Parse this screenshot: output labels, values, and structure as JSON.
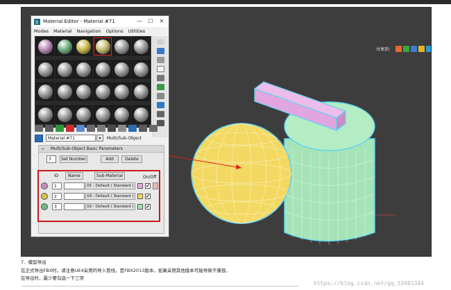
{
  "window": {
    "title": "Material Editor - Material #71",
    "minimize": "—",
    "maximize": "☐",
    "close": "✕"
  },
  "menu": [
    "Modes",
    "Material",
    "Navigation",
    "Options",
    "Utilities"
  ],
  "material_slots": {
    "rows": 4,
    "cols": 6,
    "selected_index": 3,
    "sample_colors": [
      "#b98ab7",
      "#6fae80",
      "#c9b64a",
      "#c4b96e"
    ]
  },
  "name_bar": {
    "material_name": "Material #71",
    "material_type": "Multi/Sub-Object"
  },
  "rollout": {
    "title": "Multi/Sub-Object Basic Parameters",
    "count_value": "3",
    "set_number_label": "Set Number",
    "add_label": "Add",
    "delete_label": "Delete",
    "col_id": "ID",
    "col_name": "Name",
    "col_submaterial": "Sub-Material",
    "col_onoff": "On/Off",
    "rows": [
      {
        "id": "1",
        "material": "01 - Default ( Standard )",
        "color": "#f0a6e4",
        "sphere": "#c48fc4",
        "checked": "✔"
      },
      {
        "id": "2",
        "material": "03 - Default ( Standard )",
        "color": "#f2dc57",
        "sphere": "#d8c24a",
        "checked": "✔"
      },
      {
        "id": "3",
        "material": "02 - Default ( Standard )",
        "color": "#a4e6b8",
        "sphere": "#74b888",
        "checked": "✔"
      }
    ]
  },
  "viewport": {
    "share_label": "分享到：",
    "share_icons": [
      "qzone-icon",
      "wechat-icon",
      "weibo-icon",
      "star-icon",
      "tencent-icon",
      "plus-icon"
    ]
  },
  "captions": {
    "line1": "7．模型导出",
    "line2": "在正式导出FBX时，请注意UE4采用的导入管线，是FBX2013版本，如果采用其他版本可能导致不兼容。",
    "line3": "在导出时，最少要勾选一下三项"
  },
  "watermark": "https://blog.csdn.net/qq_33483344",
  "colors": {
    "viewport_bg": "#3d3d3d",
    "selection_red": "#c8191c",
    "sphere_yellow": "#f3d961",
    "cylinder_green": "#a6e4b8",
    "box_pink": "#e1a6e0",
    "selection_outline": "#5fd3f0"
  }
}
